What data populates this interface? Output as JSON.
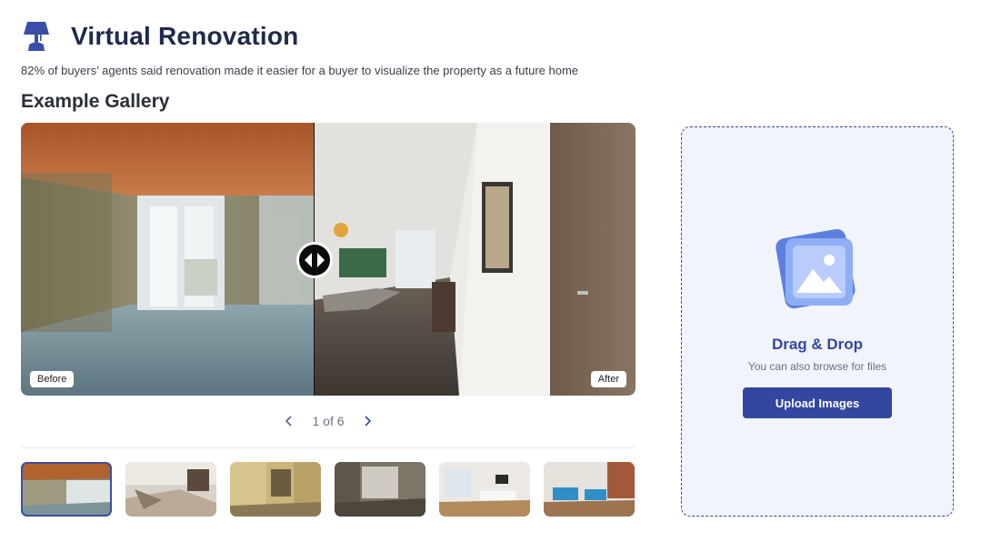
{
  "header": {
    "icon": "lamp-icon",
    "title": "Virtual Renovation",
    "subtitle": "82% of buyers’ agents said renovation made it easier for a buyer to visualize the property as a future home"
  },
  "gallery": {
    "title": "Example Gallery",
    "before_label": "Before",
    "after_label": "After",
    "pager_text": "1 of 6",
    "current": 1,
    "total": 6
  },
  "thumbnails": [
    {
      "name": "thumb-1",
      "active": true
    },
    {
      "name": "thumb-2",
      "active": false
    },
    {
      "name": "thumb-3",
      "active": false
    },
    {
      "name": "thumb-4",
      "active": false
    },
    {
      "name": "thumb-5",
      "active": false
    },
    {
      "name": "thumb-6",
      "active": false
    }
  ],
  "upload": {
    "icon": "image-upload-icon",
    "title": "Drag & Drop",
    "subtitle": "You can also browse for files",
    "button_label": "Upload Images"
  },
  "colors": {
    "accent": "#3346a0",
    "title": "#1f2a4a",
    "dropzone_bg": "#f2f4fb"
  }
}
